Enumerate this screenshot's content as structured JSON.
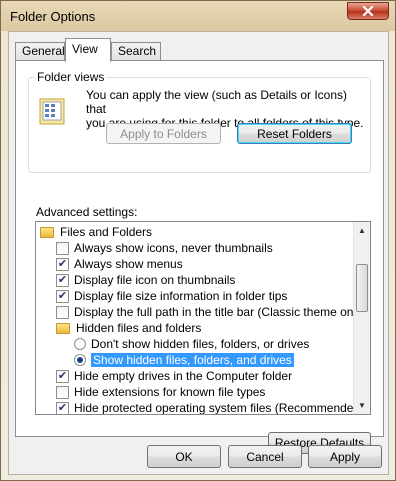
{
  "window": {
    "title": "Folder Options"
  },
  "tabs": [
    {
      "label": "General",
      "active": false
    },
    {
      "label": "View",
      "active": true
    },
    {
      "label": "Search",
      "active": false
    }
  ],
  "folder_views": {
    "title": "Folder views",
    "description_line1": "You can apply the view (such as Details or Icons) that",
    "description_line2": "you are using for this folder to all folders of this type.",
    "apply_button": "Apply to Folders",
    "reset_button": "Reset Folders"
  },
  "advanced": {
    "title": "Advanced settings:",
    "items": [
      {
        "type": "folder",
        "label": "Files and Folders",
        "indent": 0
      },
      {
        "type": "checkbox",
        "label": "Always show icons, never thumbnails",
        "checked": false,
        "indent": 1
      },
      {
        "type": "checkbox",
        "label": "Always show menus",
        "checked": true,
        "indent": 1
      },
      {
        "type": "checkbox",
        "label": "Display file icon on thumbnails",
        "checked": true,
        "indent": 1
      },
      {
        "type": "checkbox",
        "label": "Display file size information in folder tips",
        "checked": true,
        "indent": 1
      },
      {
        "type": "checkbox",
        "label": "Display the full path in the title bar (Classic theme only)",
        "checked": false,
        "indent": 1
      },
      {
        "type": "folder",
        "label": "Hidden files and folders",
        "indent": 1
      },
      {
        "type": "radio",
        "label": "Don't show hidden files, folders, or drives",
        "checked": false,
        "indent": 2
      },
      {
        "type": "radio",
        "label": "Show hidden files, folders, and drives",
        "checked": true,
        "selected": true,
        "indent": 2
      },
      {
        "type": "checkbox",
        "label": "Hide empty drives in the Computer folder",
        "checked": true,
        "indent": 1
      },
      {
        "type": "checkbox",
        "label": "Hide extensions for known file types",
        "checked": false,
        "indent": 1
      },
      {
        "type": "checkbox",
        "label": "Hide protected operating system files (Recommended)",
        "checked": true,
        "indent": 1
      }
    ],
    "restore_button": "Restore Defaults"
  },
  "footer": {
    "ok": "OK",
    "cancel": "Cancel",
    "apply": "Apply"
  },
  "colors": {
    "selection": "#3399ff",
    "title_bar": "#dcc9a3",
    "close_button": "#c7472d"
  }
}
